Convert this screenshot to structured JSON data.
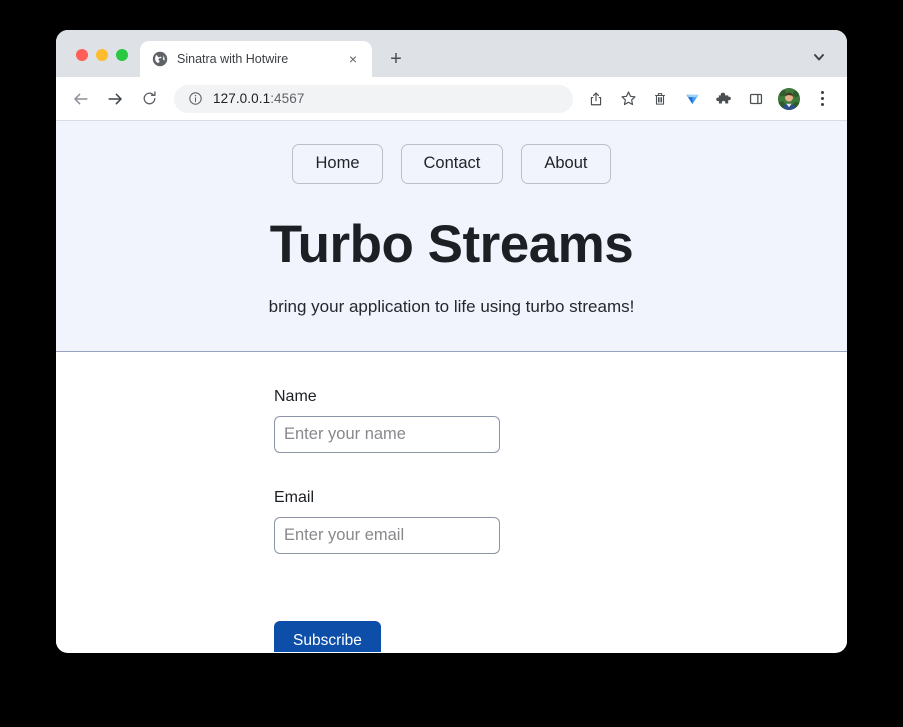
{
  "browser": {
    "window_controls": [
      {
        "name": "close",
        "color": "#ff5f57"
      },
      {
        "name": "minimize",
        "color": "#febc2e"
      },
      {
        "name": "maximize",
        "color": "#28c840"
      }
    ],
    "tab": {
      "title": "Sinatra with Hotwire",
      "favicon": "globe-icon",
      "close_label": "×"
    },
    "new_tab_label": "+",
    "tab_list_chevron": "chevron-down-icon",
    "toolbar": {
      "back_icon": "arrow-left-icon",
      "forward_icon": "arrow-right-icon",
      "reload_icon": "reload-icon",
      "site_info_icon": "info-circle-icon",
      "url_host": "127.0.0.1",
      "url_port": ":4567",
      "url_full": "127.0.0.1:4567",
      "actions": [
        {
          "name": "share-icon",
          "label": "Share"
        },
        {
          "name": "bookmark-star-icon",
          "label": "Bookmark"
        },
        {
          "name": "trash-icon",
          "label": "Delete"
        },
        {
          "name": "diamond-icon",
          "label": "Extension"
        },
        {
          "name": "puzzle-icon",
          "label": "Extensions"
        },
        {
          "name": "side-panel-icon",
          "label": "Side panel"
        }
      ],
      "avatar": "profile-avatar",
      "menu_icon": "three-dots-menu-icon"
    }
  },
  "page": {
    "nav": [
      {
        "label": "Home"
      },
      {
        "label": "Contact"
      },
      {
        "label": "About"
      }
    ],
    "hero": {
      "title": "Turbo Streams",
      "subtitle": "bring your application to life using turbo streams!",
      "background": "#f1f4fd"
    },
    "form": {
      "fields": [
        {
          "label": "Name",
          "value": "",
          "placeholder": "Enter your name"
        },
        {
          "label": "Email",
          "value": "",
          "placeholder": "Enter your email"
        }
      ],
      "submit_label": "Subscribe",
      "submit_color": "#0d4ea8"
    }
  }
}
